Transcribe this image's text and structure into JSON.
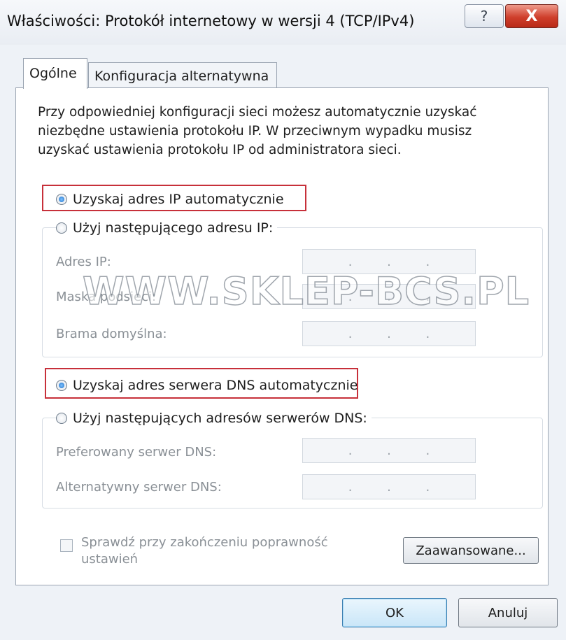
{
  "window": {
    "title": "Właściwości: Protokół internetowy w wersji 4 (TCP/IPv4)",
    "help_glyph": "?",
    "close_glyph": "X"
  },
  "tabs": [
    {
      "label": "Ogólne",
      "active": true
    },
    {
      "label": "Konfiguracja alternatywna",
      "active": false
    }
  ],
  "description": "Przy odpowiedniej konfiguracji sieci możesz automatycznie uzyskać niezbędne ustawienia protokołu IP. W przeciwnym wypadku musisz uzyskać ustawienia protokołu IP od administratora sieci.",
  "ip": {
    "auto_label": "Uzyskaj adres IP automatycznie",
    "auto_checked": true,
    "manual_label": "Użyj następującego adresu IP:",
    "manual_checked": false,
    "fields": [
      {
        "label": "Adres IP:",
        "value": ". . ."
      },
      {
        "label": "Maska podsieci:",
        "value": ". . ."
      },
      {
        "label": "Brama domyślna:",
        "value": ". . ."
      }
    ]
  },
  "dns": {
    "auto_label": "Uzyskaj adres serwera DNS automatycznie",
    "auto_checked": true,
    "manual_label": "Użyj następujących adresów serwerów DNS:",
    "manual_checked": false,
    "fields": [
      {
        "label": "Preferowany serwer DNS:",
        "value": ". . ."
      },
      {
        "label": "Alternatywny serwer DNS:",
        "value": ". . ."
      }
    ]
  },
  "validate": {
    "label": "Sprawdź przy zakończeniu poprawność ustawień",
    "checked": false
  },
  "buttons": {
    "advanced": "Zaawansowane...",
    "ok": "OK",
    "cancel": "Anuluj"
  },
  "watermark": "WWW.SKLEP-BCS.PL",
  "colors": {
    "highlight": "#c7303a",
    "close_button": "#cf3f2c",
    "window_bg": "#eef2f7"
  }
}
